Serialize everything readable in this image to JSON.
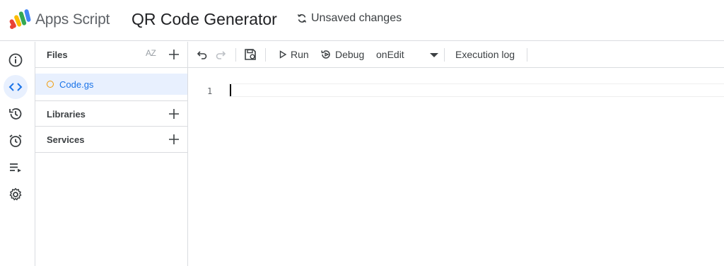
{
  "header": {
    "app_name": "Apps Script",
    "project_title": "QR Code Generator",
    "save_status": "Unsaved changes",
    "logo_icon": "apps-script-logo",
    "status_icon": "sync-icon"
  },
  "rail": {
    "items": [
      {
        "name": "overview",
        "icon": "info-icon",
        "active": false
      },
      {
        "name": "editor",
        "icon": "code-icon",
        "active": true
      },
      {
        "name": "triggers-history",
        "icon": "history-icon",
        "active": false
      },
      {
        "name": "triggers",
        "icon": "alarm-icon",
        "active": false
      },
      {
        "name": "executions",
        "icon": "executions-icon",
        "active": false
      },
      {
        "name": "settings",
        "icon": "gear-icon",
        "active": false
      }
    ]
  },
  "files_panel": {
    "files_label": "Files",
    "sort_label": "AZ",
    "files": [
      {
        "name": "Code.gs"
      }
    ],
    "libraries_label": "Libraries",
    "services_label": "Services"
  },
  "toolbar": {
    "run_label": "Run",
    "debug_label": "Debug",
    "selected_function": "onEdit",
    "execution_log_label": "Execution log"
  },
  "editor": {
    "lines": [
      "1"
    ]
  },
  "colors": {
    "accent": "#1a73e8",
    "active_bg": "#e8f0fe",
    "file_dot": "#f29900",
    "border": "#dadce0"
  }
}
